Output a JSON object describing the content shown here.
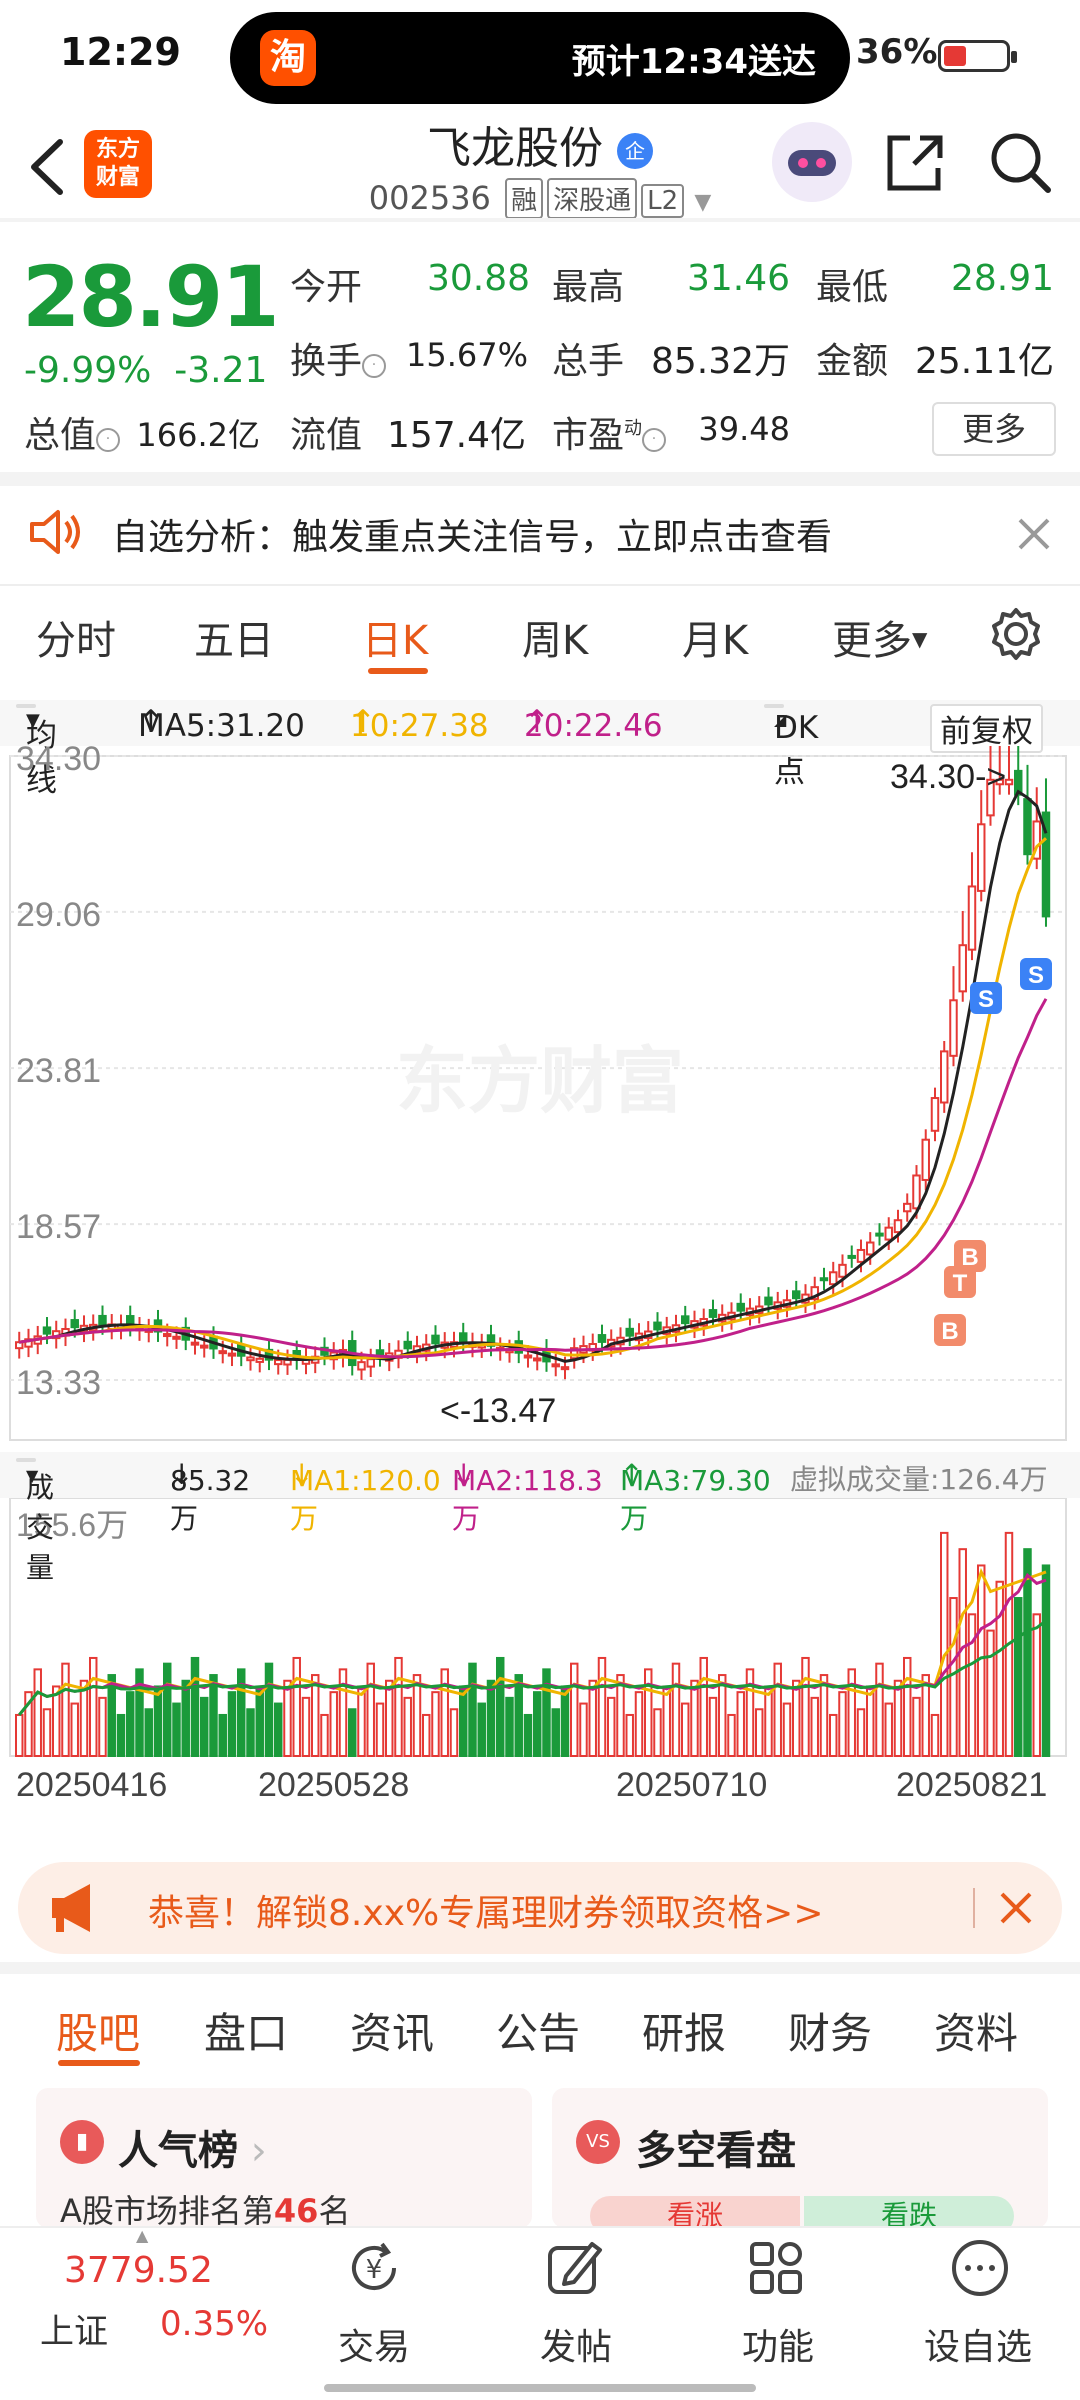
{
  "status_bar": {
    "time": "12:29",
    "taobao_glyph": "淘",
    "dynamic_text": "预计12:34送达",
    "battery": "36%"
  },
  "header": {
    "logo_line1": "东方",
    "logo_line2": "财富",
    "stock_name": "飞龙股份",
    "name_badge": "企",
    "stock_code": "002536",
    "tag_margin": "融",
    "tag_connect": "深股通",
    "tag_level": "L2"
  },
  "quote": {
    "price": "28.91",
    "change_pct": "-9.99%",
    "change_abs": "-3.21",
    "open_label": "今开",
    "open": "30.88",
    "high_label": "最高",
    "high": "31.46",
    "low_label": "最低",
    "low": "28.91",
    "turnover_label": "换手",
    "turnover": "15.67%",
    "volume_label": "总手",
    "volume": "85.32万",
    "amount_label": "金额",
    "amount": "25.11亿",
    "mktcap_label": "总值",
    "mktcap": "166.2亿",
    "float_label": "流值",
    "float": "157.4亿",
    "pe_label": "市盈",
    "pe_sup": "动",
    "pe": "39.48",
    "more_label": "更多"
  },
  "notice": {
    "text": "自选分析：触发重点关注信号，立即点击查看"
  },
  "chart_tabs": [
    "分时",
    "五日",
    "日K",
    "周K",
    "月K",
    "更多"
  ],
  "ma_bar": {
    "selector": "均线",
    "ma5": "MA5:31.20",
    "ma10": "10:27.38",
    "ma20": "20:22.46",
    "dk_label": "DK点",
    "adjust_label": "前复权"
  },
  "chart_data": {
    "type": "candlestick",
    "y_ticks": [
      "34.30",
      "29.06",
      "23.81",
      "18.57",
      "13.33"
    ],
    "ylim": [
      13.33,
      34.3
    ],
    "max_annotation": "34.30->",
    "min_annotation": "<-13.47",
    "watermark": "东方财富",
    "signals": [
      "S",
      "S",
      "B",
      "T",
      "B"
    ],
    "vol_max_label": "155.6万",
    "dates": [
      "20250416",
      "20250528",
      "20250710",
      "20250821"
    ]
  },
  "volume_bar": {
    "selector": "成交量",
    "vol": "85.32万",
    "ma1": "MA1:120.0万",
    "ma2": "MA2:118.3万",
    "ma3": "MA3:79.30万",
    "virtual": "虚拟成交量:126.4万"
  },
  "promo": {
    "text": "恭喜！解锁8.xx%专属理财券领取资格>>"
  },
  "bottom_tabs": [
    "股吧",
    "盘口",
    "资讯",
    "公告",
    "研报",
    "财务",
    "资料"
  ],
  "cards": {
    "popularity_title": "人气榜",
    "popularity_sub": "A股市场排名第",
    "popularity_rank": "46",
    "popularity_unit": "名",
    "longshort_title": "多空看盘",
    "bull": "看涨",
    "bear": "看跌"
  },
  "bottom_bar": {
    "index_value": "3779.52",
    "index_name": "上证",
    "index_change": "0.35%",
    "trade": "交易",
    "post": "发帖",
    "function": "功能",
    "watchlist": "设自选"
  }
}
